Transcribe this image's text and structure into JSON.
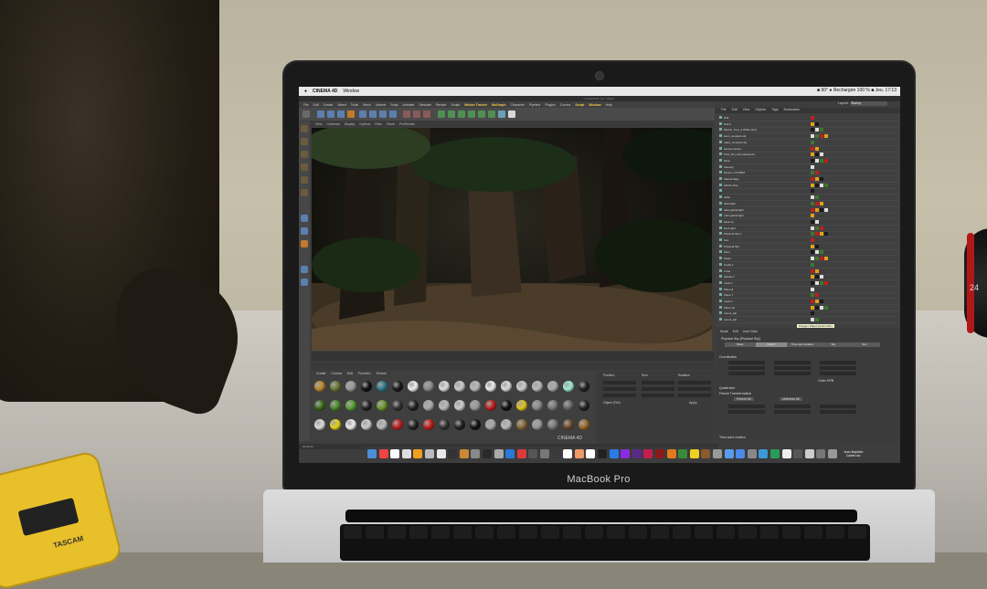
{
  "scene": {
    "laptop_label": "MacBook Pro",
    "lens_number": "24",
    "recorder_brand": "TASCAM"
  },
  "mac_menubar": {
    "app": "CINEMA 4D",
    "items": [
      "Window"
    ],
    "status_right": "■ 50°  ● Rechargée     100 %  ■  Jeu. 17:13"
  },
  "window_title": "temple2020.c4d * (Main)",
  "c4d_menu": [
    "File",
    "Edit",
    "Create",
    "Select",
    "Tools",
    "Mesh",
    "Volume",
    "Snap",
    "Animate",
    "Simulate",
    "Render",
    "Sculpt",
    "Motion Tracker",
    "MoGraph",
    "Character",
    "Pipeline",
    "Plugins",
    "Corona",
    "Script",
    "Window",
    "Help"
  ],
  "viewport_menu": [
    "View",
    "Cameras",
    "Display",
    "Options",
    "Filter",
    "Panel",
    "ProRender"
  ],
  "material_menu": [
    "Create",
    "Corona",
    "Edit",
    "Function",
    "Texture"
  ],
  "materials_row_labels": [
    "Mat",
    "Mat",
    "Mat",
    "Mat",
    "Mat",
    "Mat"
  ],
  "c4d_logo": "CINEMA 4D",
  "coord_manager": {
    "headers": [
      "Position",
      "Size",
      "Rotation"
    ],
    "apply": "Apply",
    "mode": "Object (Rel)"
  },
  "object_manager": {
    "tabs": [
      "File",
      "Edit",
      "View",
      "Objects",
      "Tags",
      "Bookmarks"
    ],
    "layout_label": "Layout:",
    "layout_value": "Startup",
    "rows": [
      "Null",
      "Null.2",
      "Sketch_Tree_3 White.obj.2",
      "stem_sunplant.obj",
      "mass_compact.obj",
      "camera shrew",
      "Post_thin_soil natural.obj",
      "fama",
      "Scenery",
      "bitmen x STORM",
      "Stands flags",
      "Aktstb ciltre",
      "",
      "white",
      "draw light",
      "draw global light",
      "main global light",
      "back up",
      "boss light",
      "Physical Sky.1",
      "Sun",
      "Physical Sky",
      "Floor",
      "Scale",
      "Crabs.1",
      "Cube",
      "default.2",
      "mesh.1",
      "Plane.8",
      "Plane.7",
      "mesh.1",
      "Plane.10",
      "mount_tail",
      "mount_tail"
    ]
  },
  "tooltip": "Polygon Object [Arch1.001]",
  "attribute_manager": {
    "tabs": [
      "Mode",
      "Edit",
      "User Data"
    ],
    "title": "Physical Sky [Physical Sky]",
    "bar": [
      "Basic",
      "Coord.",
      "Time and Location",
      "Sky",
      "Sun"
    ],
    "sections": [
      "Coordinates",
      "Quaternion",
      "Freeze Transformation",
      "Time and Location"
    ],
    "order": "Order HPB",
    "freeze_buttons": [
      "Freeze All",
      "Unfreeze All"
    ]
  },
  "status_bar": "00:00:44",
  "user": {
    "name": "Jean-Baptiste",
    "surname": "Castel.olo"
  },
  "colors": {
    "accent_yellow": "#f6c94a",
    "screen_bg": "#3d3d3d"
  }
}
